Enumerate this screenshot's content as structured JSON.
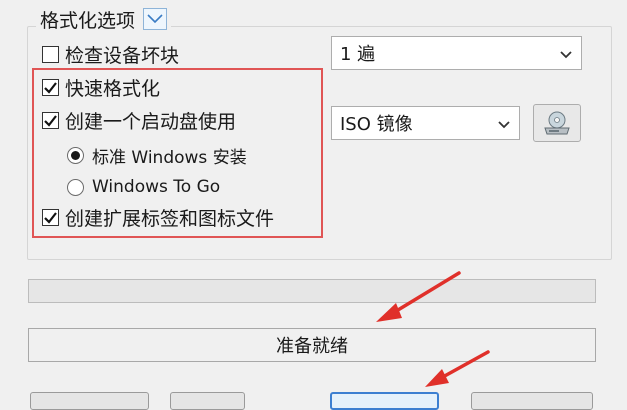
{
  "format_options": {
    "title": "格式化选项",
    "check_bad_blocks": {
      "label": "检查设备坏块",
      "checked": false
    },
    "passes_select": {
      "value": "1 遍"
    },
    "quick_format": {
      "label": "快速格式化",
      "checked": true
    },
    "create_bootable": {
      "label": "创建一个启动盘使用",
      "checked": true
    },
    "image_type_select": {
      "value": "ISO 镜像"
    },
    "radio_standard": {
      "label": "标准 Windows 安装",
      "selected": true
    },
    "radio_to_go": {
      "label": "Windows To Go",
      "selected": false
    },
    "extended_label": {
      "label": "创建扩展标签和图标文件",
      "checked": true
    }
  },
  "progress": {
    "value": 0
  },
  "status": {
    "text": "准备就绪"
  },
  "icons": {
    "legend_toggle": "chevron-down-icon",
    "select_caret": "chevron-down-icon",
    "disk_image": "disk-drive-icon"
  },
  "colors": {
    "highlight_frame": "#e05555",
    "annotation_arrow": "#e0302a",
    "primary_button_border": "#3c7fd1",
    "progress_fill": "#06b025"
  }
}
